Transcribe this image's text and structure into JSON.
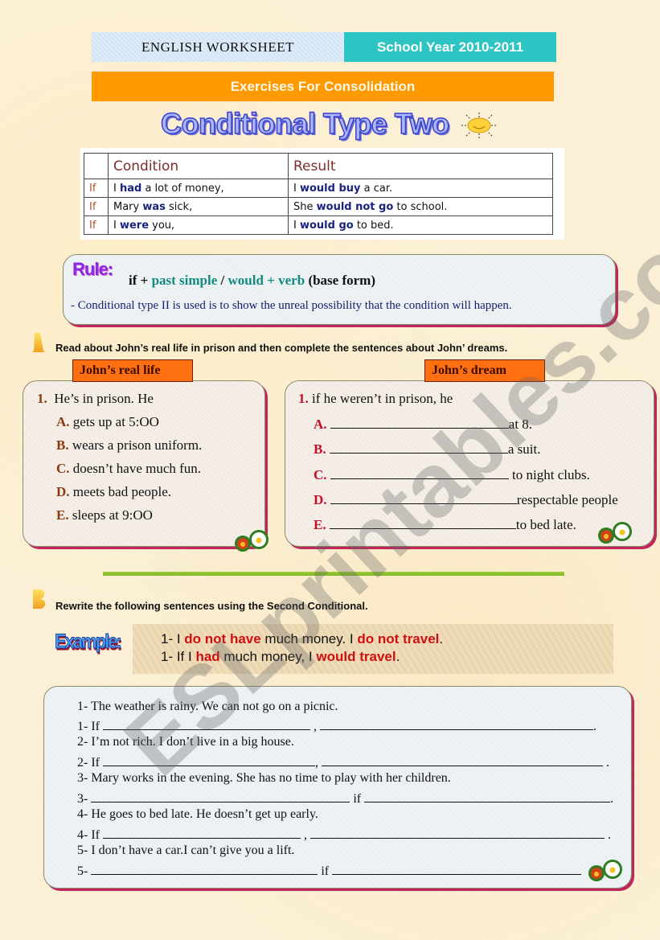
{
  "header": {
    "left_title": "ENGLISH WORKSHEET",
    "school_year": "School Year 2010-2011",
    "band": "Exercises For Consolidation",
    "main_title": "Conditional Type Two",
    "title_icon": "sun-icon"
  },
  "grammar_table": {
    "columns": [
      "",
      "Condition",
      "Result"
    ],
    "rows": [
      {
        "if": "If",
        "condition": [
          {
            "t": "I ",
            "kw": false
          },
          {
            "t": "had",
            "kw": true
          },
          {
            "t": " a lot of money,",
            "kw": false
          }
        ],
        "result": [
          {
            "t": "I ",
            "kw": false
          },
          {
            "t": "would buy",
            "kw": true
          },
          {
            "t": " a car.",
            "kw": false
          }
        ]
      },
      {
        "if": "If",
        "condition": [
          {
            "t": "Mary ",
            "kw": false
          },
          {
            "t": "was",
            "kw": true
          },
          {
            "t": " sick,",
            "kw": false
          }
        ],
        "result": [
          {
            "t": "She ",
            "kw": false
          },
          {
            "t": "would not go",
            "kw": true
          },
          {
            "t": " to school.",
            "kw": false
          }
        ]
      },
      {
        "if": "If",
        "condition": [
          {
            "t": "I ",
            "kw": false
          },
          {
            "t": "were",
            "kw": true
          },
          {
            "t": " you,",
            "kw": false
          }
        ],
        "result": [
          {
            "t": "I ",
            "kw": false
          },
          {
            "t": "would go",
            "kw": true
          },
          {
            "t": " to bed.",
            "kw": false
          }
        ]
      }
    ]
  },
  "rule": {
    "label": "Rule:",
    "formula": {
      "p1": "if + ",
      "p2": "past simple",
      "p3": " / ",
      "p4": "would + verb",
      "p5": " (base form)"
    },
    "description": "- Conditional type II is used is to show the unreal possibility that the condition will happen."
  },
  "section_a": {
    "letter": "A",
    "instruction": "Read about John’s real life in prison and then complete the sentences about John’ dreams.",
    "real_life": {
      "tag": "John’s real life",
      "intro_num": "1.",
      "intro": "He’s in prison.  He",
      "items": [
        {
          "letter": "A.",
          "text": "gets up at 5:OO"
        },
        {
          "letter": "B.",
          "text": "wears a prison uniform."
        },
        {
          "letter": "C.",
          "text": "doesn’t have much fun."
        },
        {
          "letter": "D.",
          "text": "meets bad people."
        },
        {
          "letter": "E.",
          "text": "sleeps at 9:OO"
        }
      ]
    },
    "dream": {
      "tag": "John’s dream",
      "intro_num": "1.",
      "intro": "if he weren’t in prison, he",
      "items": [
        {
          "letter": "A.",
          "value": "",
          "suffix": "at 8."
        },
        {
          "letter": "B.",
          "value": "",
          "suffix": "a suit."
        },
        {
          "letter": "C.",
          "value": "",
          "suffix": " to night clubs."
        },
        {
          "letter": "D.",
          "value": "",
          "suffix": "respectable people"
        },
        {
          "letter": "E.",
          "value": "",
          "suffix": "to bed late."
        }
      ]
    }
  },
  "section_b": {
    "letter": "B",
    "instruction": "Rewrite the following sentences using the Second Conditional.",
    "example_label": "Example:",
    "example": {
      "line1": {
        "n": "1-  I ",
        "r1": "do not have",
        "m": " much money. I ",
        "r2": "do not travel",
        "e": "."
      },
      "line2": {
        "n": "1-  If I ",
        "r1": "had",
        "m": " much money, I ",
        "r2": "would travel",
        "e": "."
      }
    },
    "exercises": [
      {
        "sentence": "1-  The weather is rainy. We can not go on a picnic.",
        "prefix": "1-  If",
        "joiner": ",",
        "end": ".",
        "answer1": "",
        "answer2": ""
      },
      {
        "sentence": "2-  I’m not rich. I don’t live in a big house.",
        "prefix": "2- If",
        "joiner": ",",
        "end": ".",
        "answer1": "",
        "answer2": ""
      },
      {
        "sentence": "3- Mary works in the evening. She has no time to play with her children.",
        "prefix": "3-",
        "joiner": "if",
        "end": ".",
        "answer1": "",
        "answer2": ""
      },
      {
        "sentence": "4- He goes to bed late. He doesn’t get up early.",
        "prefix": "4- If",
        "joiner": ",",
        "end": ".",
        "answer1": "",
        "answer2": ""
      },
      {
        "sentence": "5- I don’t have a car.I can’t give you a lift.",
        "prefix": "5-",
        "joiner": "if",
        "end": "",
        "answer1": "",
        "answer2": ""
      }
    ]
  },
  "watermark": "ESLprintables.com",
  "colors": {
    "school_year_bg": "#2ec4c4",
    "band_bg": "#fe9a00",
    "tag_bg": "#fe6f11",
    "panel_shadow": "#c2245c",
    "keyword_blue": "#1a237e",
    "teal": "#138a80",
    "example_red": "#d01010",
    "divider_green": "#8cc230"
  }
}
